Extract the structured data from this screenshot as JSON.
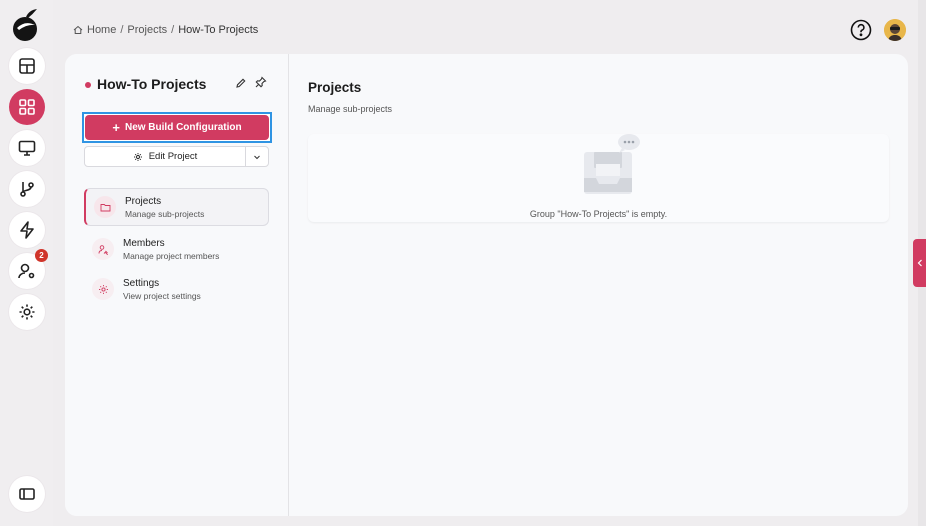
{
  "breadcrumb": {
    "items": [
      "Home",
      "Projects",
      "How-To Projects"
    ],
    "separator": "/"
  },
  "rail": {
    "items": [
      {
        "name": "dashboard",
        "icon": "layout-icon",
        "active": false
      },
      {
        "name": "projects",
        "icon": "grid-icon",
        "active": true
      },
      {
        "name": "agents",
        "icon": "monitor-icon",
        "active": false
      },
      {
        "name": "vcs",
        "icon": "git-branch-icon",
        "active": false
      },
      {
        "name": "builds",
        "icon": "lightning-icon",
        "active": false
      },
      {
        "name": "users",
        "icon": "user-settings-icon",
        "active": false,
        "badge": "2"
      },
      {
        "name": "settings",
        "icon": "gear-icon",
        "active": false
      }
    ],
    "collapse_icon": "sidebar-toggle-icon"
  },
  "project": {
    "title": "How-To Projects",
    "status_color": "#d13b61"
  },
  "actions": {
    "new_build": "New Build Configuration",
    "edit_project": "Edit Project"
  },
  "nav": [
    {
      "label": "Projects",
      "sub": "Manage sub-projects",
      "icon": "folder-icon",
      "active": true
    },
    {
      "label": "Members",
      "sub": "Manage project members",
      "icon": "members-icon",
      "active": false
    },
    {
      "label": "Settings",
      "sub": "View project settings",
      "icon": "gear-icon",
      "active": false
    }
  ],
  "content": {
    "title": "Projects",
    "subtitle": "Manage sub-projects",
    "empty_text": "Group \"How-To Projects\" is empty."
  },
  "colors": {
    "accent": "#d13b61",
    "focus": "#2f94e3"
  }
}
